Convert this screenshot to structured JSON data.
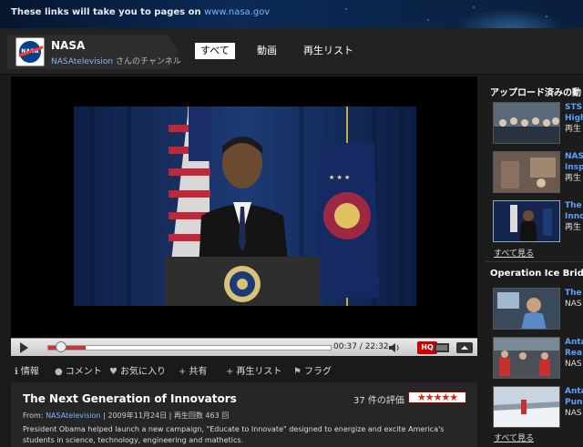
{
  "banner": {
    "text": "These links will take you to pages on",
    "url": "www.nasa.gov"
  },
  "channel": {
    "name": "NASA",
    "user": "NASAtelevision",
    "suffix": " さんのチャンネル",
    "logo_text": "NASA"
  },
  "tabs": [
    {
      "label": "すべて",
      "active": true
    },
    {
      "label": "動画",
      "active": false
    },
    {
      "label": "再生リスト",
      "active": false
    }
  ],
  "player": {
    "current_time": "00:37",
    "total_time": "22:32",
    "progress": 0.03,
    "buffered": 0.13,
    "hq_label": "HQ"
  },
  "actions": [
    {
      "icon": "info-icon",
      "glyph": "ℹ",
      "label": "情報"
    },
    {
      "icon": "comment-icon",
      "glyph": "●",
      "label": "コメント"
    },
    {
      "icon": "heart-icon",
      "glyph": "♥",
      "label": "お気に入り"
    },
    {
      "icon": "plus-icon",
      "glyph": "+",
      "label": "共有"
    },
    {
      "icon": "plus-icon",
      "glyph": "+",
      "label": "再生リスト"
    },
    {
      "icon": "flag-icon",
      "glyph": "⚑",
      "label": "フラグ"
    }
  ],
  "video": {
    "title": "The Next Generation of Innovators",
    "rating_text": "37 件の評価",
    "stars": "★★★★★",
    "from_label": "From:",
    "from_user": "NASAtelevision",
    "date": "2009年11月24日",
    "views_label": "再生回数",
    "views": "463",
    "views_suffix": "回",
    "description": "President Obama helped launch a new campaign, \"Educate to Innovate\" designed to energize and excite America's students in science, technology, engineering and mathetics."
  },
  "sidebar": {
    "section1": {
      "title": "アップロード済みの動",
      "items": [
        {
          "title": "STS",
          "title2": "High",
          "sub": "再生"
        },
        {
          "title": "NAS",
          "title2": "Insp",
          "sub": "再生"
        },
        {
          "title": "The",
          "title2": "Inno",
          "sub": "再生"
        }
      ],
      "see_all": "すべて見る"
    },
    "section2": {
      "title": "Operation Ice Bridge",
      "items": [
        {
          "title": "The",
          "title2": "",
          "sub": "NAS"
        },
        {
          "title": "Anta",
          "title2": "Rea",
          "sub": "NAS"
        },
        {
          "title": "Anta",
          "title2": "Pun",
          "sub": "NAS"
        }
      ],
      "see_all": "すべて見る"
    }
  }
}
